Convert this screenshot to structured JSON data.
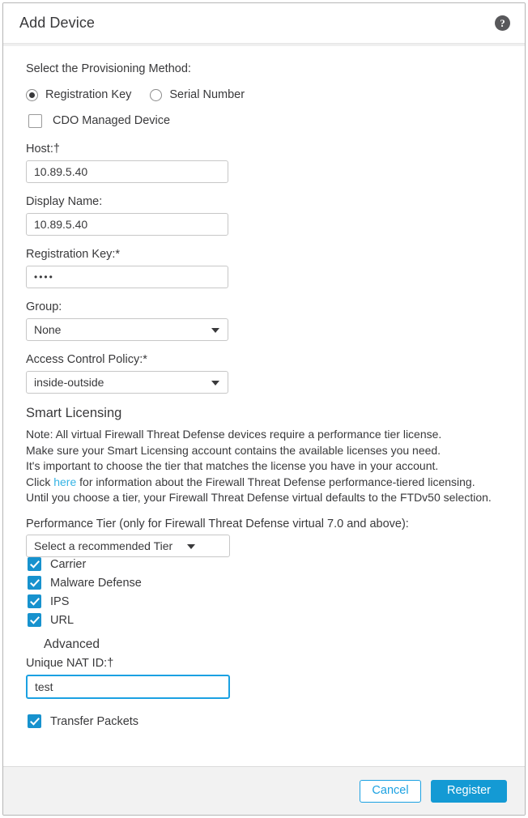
{
  "dialog": {
    "title": "Add Device",
    "help_icon": "help-circle-icon"
  },
  "provisioning": {
    "label": "Select the Provisioning Method:",
    "options": [
      {
        "label": "Registration Key",
        "selected": true
      },
      {
        "label": "Serial Number",
        "selected": false
      }
    ],
    "cdo_managed": {
      "label": "CDO Managed Device",
      "checked": false
    }
  },
  "fields": {
    "host": {
      "label": "Host:†",
      "value": "10.89.5.40",
      "placeholder": ""
    },
    "display_name": {
      "label": "Display Name:",
      "value": "10.89.5.40",
      "placeholder": ""
    },
    "registration_key": {
      "label": "Registration Key:*",
      "value": "••••",
      "placeholder": ""
    },
    "group": {
      "label": "Group:",
      "value": "None"
    },
    "access_control_policy": {
      "label": "Access Control Policy:*",
      "value": "inside-outside"
    }
  },
  "smart_licensing": {
    "title": "Smart Licensing",
    "notes": [
      "Note: All virtual Firewall Threat Defense devices require a performance tier license.",
      "Make sure your Smart Licensing account contains the available licenses you need.",
      "It's important to choose the tier that matches the license you have in your account."
    ],
    "link_line": {
      "before": "Click ",
      "link": "here",
      "after": " for information about the Firewall Threat Defense performance-tiered licensing."
    },
    "last_note": "Until you choose a tier, your Firewall Threat Defense virtual defaults to the FTDv50 selection.",
    "tier": {
      "label": "Performance Tier (only for Firewall Threat Defense virtual 7.0 and above):",
      "value": "Select a recommended Tier"
    },
    "licenses": [
      {
        "label": "Carrier",
        "checked": true
      },
      {
        "label": "Malware Defense",
        "checked": true
      },
      {
        "label": "IPS",
        "checked": true
      },
      {
        "label": "URL",
        "checked": true
      }
    ]
  },
  "advanced": {
    "title": "Advanced",
    "unique_nat_id": {
      "label": "Unique NAT ID:†",
      "value": "test",
      "placeholder": ""
    },
    "transfer_packets": {
      "label": "Transfer Packets",
      "checked": true
    }
  },
  "footer": {
    "cancel_label": "Cancel",
    "register_label": "Register"
  },
  "colors": {
    "accent_blue": "#149ad4",
    "link_blue": "#35b3e4",
    "checkbox_blue": "#1792ce",
    "focus_blue": "#1ba1e2",
    "footer_bg": "#f2f2f2"
  }
}
